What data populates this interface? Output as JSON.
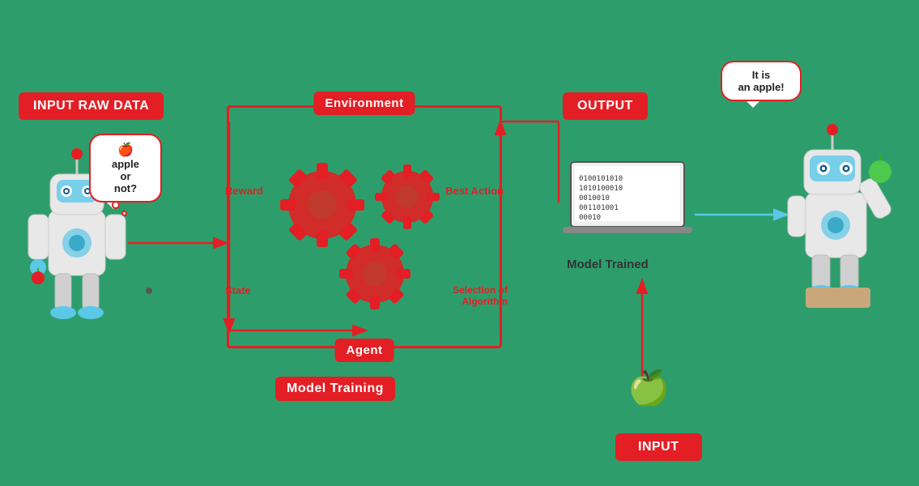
{
  "labels": {
    "input_raw_data": "INPUT RAW DATA",
    "output": "OUTPUT",
    "input": "INPUT",
    "environment": "Environment",
    "agent": "Agent",
    "model_training": "Model Training",
    "model_trained": "Model Trained",
    "reward": "Reward",
    "state": "State",
    "best_action": "Best Action",
    "selection_of_algorithm": "Selection of\nAlgorithm"
  },
  "bubbles": {
    "left": "apple\nor\nnot?",
    "right": "It is\nan apple!"
  },
  "binary": {
    "lines": [
      "0100101010",
      "1010100010",
      "0010010",
      "001101001",
      "00010"
    ]
  },
  "colors": {
    "red": "#e31e24",
    "green_bg": "#2d9e6b",
    "white": "#ffffff",
    "dark": "#222222"
  }
}
